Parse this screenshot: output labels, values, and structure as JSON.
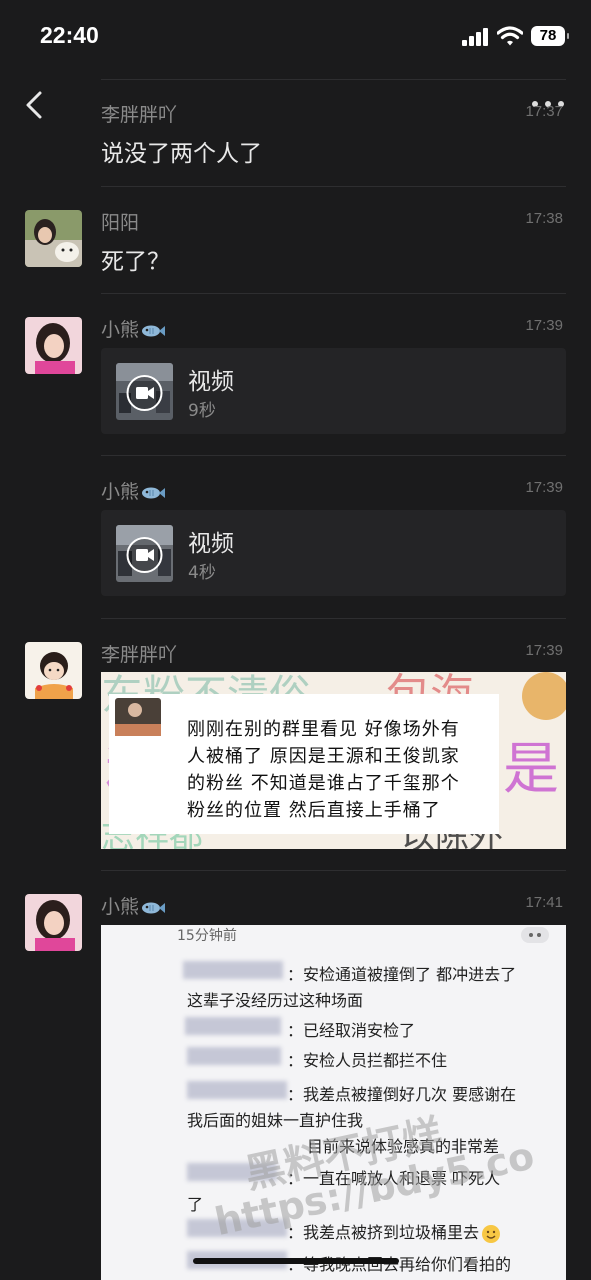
{
  "status": {
    "time": "22:40",
    "battery": "78"
  },
  "messages": [
    {
      "sender": "李胖胖吖",
      "time": "17:37",
      "text": "说没了两个人了"
    },
    {
      "sender": "阳阳",
      "time": "17:38",
      "text": "死了？"
    },
    {
      "sender": "小熊",
      "time": "17:39",
      "video_label": "视频",
      "duration": "9秒"
    },
    {
      "sender": "小熊",
      "time": "17:39",
      "video_label": "视频",
      "duration": "4秒"
    },
    {
      "sender": "李胖胖吖",
      "time": "17:39",
      "image_text": [
        "刚刚在别的群里看见 好像场外有",
        "人被桶了 原因是王源和王俊凯家",
        "的粉丝 不知道是谁占了千玺那个",
        "粉丝的位置 然后直接上手桶了"
      ]
    },
    {
      "sender": "小熊",
      "time": "17:41"
    }
  ],
  "screenshot": {
    "header_time": "15分钟前",
    "lines": [
      "：安检通道被撞倒了 都冲进去了",
      "这辈子没经历过这种场面",
      "：已经取消安检了",
      "：安检人员拦都拦不住",
      "：我差点被撞倒好几次 要感谢在",
      "我后面的姐妹一直护住我",
      "目前来说体验感真的非常差",
      "：一直在喊放人和退票 吓死人",
      "了",
      "：我差点被挤到垃圾桶里去",
      "：等我晚点回去再给你们看拍的"
    ]
  },
  "watermark": {
    "line1": "黑料不打烊",
    "line2": "https://bdy5.co"
  },
  "icons": [
    "back-arrow-icon",
    "more-icon",
    "video-play-icon",
    "fish-icon",
    "smile-emoji-icon",
    "signal-icon",
    "wifi-icon",
    "battery-icon"
  ]
}
